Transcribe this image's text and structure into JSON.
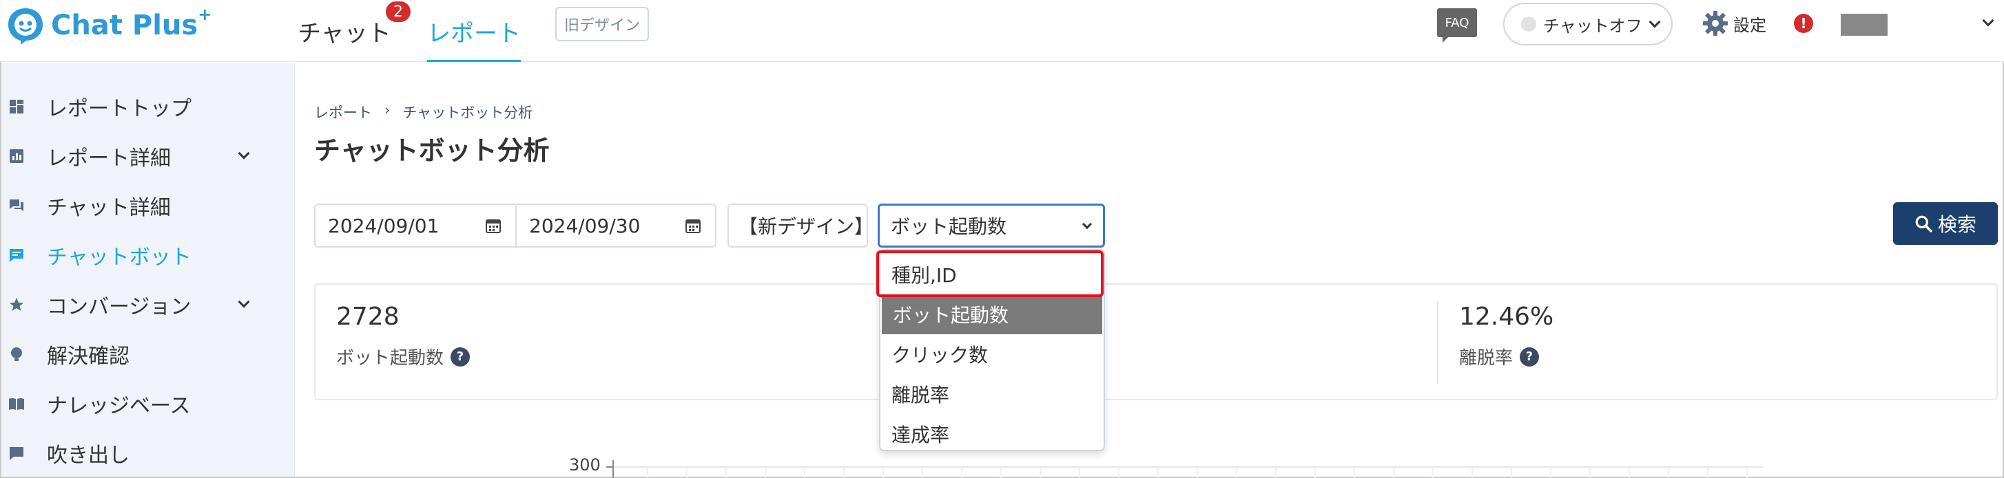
{
  "header": {
    "logo_text": "Chat Plus",
    "logo_plus": "+",
    "tabs": [
      {
        "label": "チャット",
        "badge": "2"
      },
      {
        "label": "レポート"
      }
    ],
    "old_design_label": "旧デザイン",
    "faq_label": "FAQ",
    "chat_status_label": "チャットオフ",
    "settings_label": "設定",
    "alert_label": "!"
  },
  "sidebar": {
    "items": [
      {
        "label": "レポートトップ"
      },
      {
        "label": "レポート詳細"
      },
      {
        "label": "チャット詳細"
      },
      {
        "label": "チャットボット"
      },
      {
        "label": "コンバージョン"
      },
      {
        "label": "解決確認"
      },
      {
        "label": "ナレッジベース"
      },
      {
        "label": "吹き出し"
      }
    ]
  },
  "main": {
    "breadcrumb": [
      "レポート",
      "チャットボット分析"
    ],
    "breadcrumb_sep": "›",
    "title": "チャットボット分析",
    "filters": {
      "date_from": "2024/09/01",
      "date_to": "2024/09/30",
      "design_value": "【新デザイン】",
      "metric_value": "ボット起動数"
    },
    "search_label": "検索",
    "stats": [
      {
        "value": "2728",
        "label": "ボット起動数",
        "help": "?"
      },
      {
        "value": "12.46%",
        "label": "離脱率",
        "help": "?"
      }
    ],
    "dropdown_options": [
      "種別,ID",
      "ボット起動数",
      "クリック数",
      "離脱率",
      "達成率"
    ],
    "selected_option_index": 1
  },
  "chart_data": {
    "type": "bar",
    "y_tick_visible": "300"
  },
  "colors": {
    "accent": "#1ea6e0",
    "primary_button": "#1d3f6e",
    "badge": "#d62b2b",
    "highlight": "#e0141e",
    "selected_option": "#7a7a7a"
  }
}
